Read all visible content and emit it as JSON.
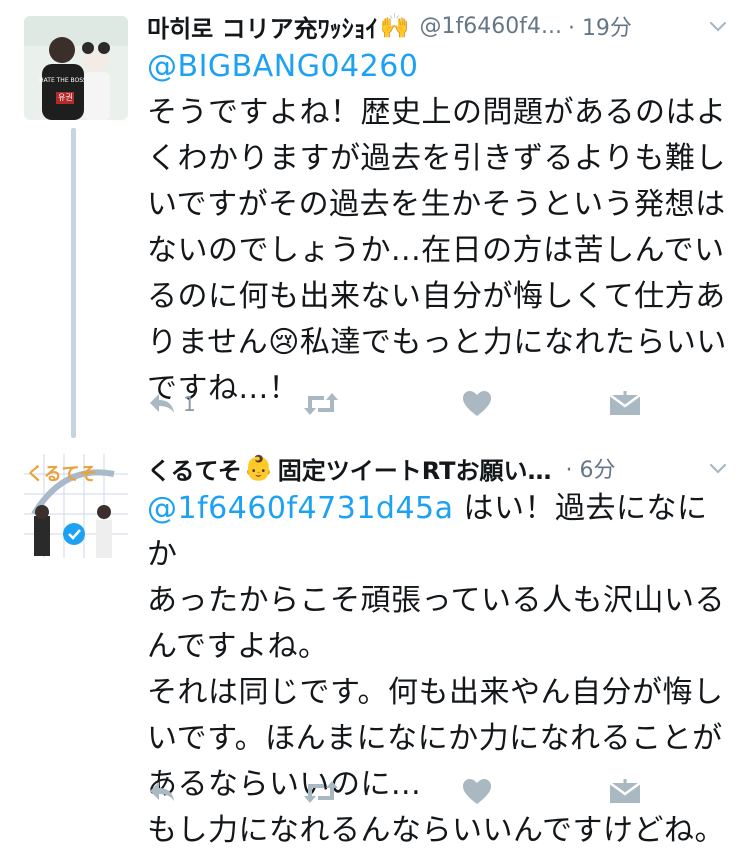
{
  "tweets": [
    {
      "name": "마히로 コリア充ﾜｯｼｮｲ",
      "emoji": "🙌",
      "handle": "@1f6460f4...",
      "time": "· 19分",
      "reply_to": "@BIGBANG04260",
      "lines": [
        "そうですよね！歴史上の問題があるのはよ",
        "くわかりますが過去を引きずるよりも難し",
        "いですがその過去を生かそうという発想は",
        "ないのでしょうか...在日の方は苦しんでい",
        "るのに何も出来ない自分が悔しくて仕方あ",
        "りません😢私達でもっと力になれたらいい",
        "ですね...！"
      ],
      "reply_count": "1",
      "avatar_text": "유권"
    },
    {
      "name": "くるてそ",
      "emoji": "👶",
      "name_suffix": "固定ツイートRTお願い…",
      "time": "· 6分",
      "mention": "@1f6460f4731d45a",
      "first_line_rest": " はい！過去になにか",
      "lines": [
        "あったからこそ頑張っている人も沢山いる",
        "んですよね。",
        "それは同じです。何も出来やん自分が悔し",
        "いです。ほんまになにか力になれることが",
        "あるならいいのに...",
        "もし力になれるんならいいんですけどね。"
      ],
      "avatar_text": "くるてそ"
    }
  ],
  "icons": {
    "reply": "reply-icon",
    "retweet": "retweet-icon",
    "like": "heart-icon",
    "dm": "envelope-icon",
    "caret": "chevron-down-icon"
  },
  "colors": {
    "link": "#1da1f2",
    "muted": "#657786",
    "icon": "#aab8c2",
    "thread_line": "#c8d4dd"
  }
}
